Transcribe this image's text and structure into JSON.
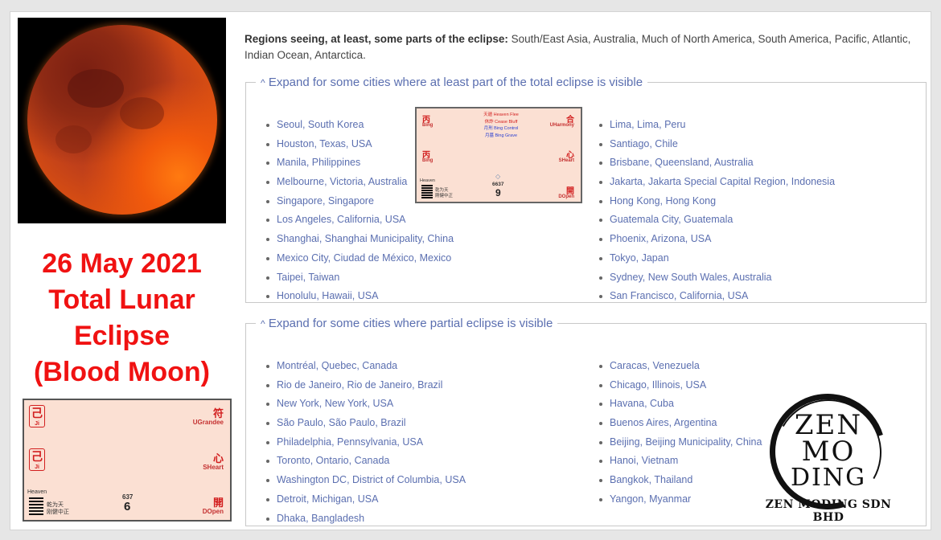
{
  "headline": {
    "line1": "26 May 2021",
    "line2": "Total Lunar",
    "line3": "Eclipse",
    "line4": "(Blood Moon)"
  },
  "regions": {
    "label": "Regions seeing, at least, some parts of the eclipse:",
    "text": " South/East Asia, Australia, Much of North America, South America, Pacific, Atlantic, Indian Ocean, Antarctica."
  },
  "total_section": {
    "legend": "Expand for some cities where at least part of the total eclipse is visible",
    "col1": [
      "Seoul, South Korea",
      "Houston, Texas, USA",
      "Manila, Philippines",
      "Melbourne, Victoria, Australia",
      "Singapore, Singapore",
      "Los Angeles, California, USA",
      "Shanghai, Shanghai Municipality, China",
      "Mexico City, Ciudad de México, Mexico",
      "Taipei, Taiwan",
      "Honolulu, Hawaii, USA"
    ],
    "col2": [
      "Lima, Lima, Peru",
      "Santiago, Chile",
      "Brisbane, Queensland, Australia",
      "Jakarta, Jakarta Special Capital Region, Indonesia",
      "Hong Kong, Hong Kong",
      "Guatemala City, Guatemala",
      "Phoenix, Arizona, USA",
      "Tokyo, Japan",
      "Sydney, New South Wales, Australia",
      "San Francisco, California, USA"
    ]
  },
  "partial_section": {
    "legend": "Expand for some cities where partial eclipse is visible",
    "col1": [
      "Montréal, Quebec, Canada",
      "Rio de Janeiro, Rio de Janeiro, Brazil",
      "New York, New York, USA",
      "São Paulo, São Paulo, Brazil",
      "Philadelphia, Pennsylvania, USA",
      "Toronto, Ontario, Canada",
      "Washington DC, District of Columbia, USA",
      "Detroit, Michigan, USA",
      "Dhaka, Bangladesh"
    ],
    "col2": [
      "Caracas, Venezuela",
      "Chicago, Illinois, USA",
      "Havana, Cuba",
      "Buenos Aires, Argentina",
      "Beijing, Beijing Municipality, China",
      "Hanoi, Vietnam",
      "Bangkok, Thailand",
      "Yangon, Myanmar"
    ]
  },
  "chart_small": {
    "tl_stem": "丙",
    "tl_sub": "Bing",
    "ml_stem": "丙",
    "ml_sub": "Bing",
    "tr_char": "合",
    "tr_sub": "UHarmony",
    "mr_char": "心",
    "mr_sub": "SHeart",
    "br_char": "開",
    "br_sub": "DOpen",
    "stars": [
      "天遁 Heaven Flee",
      "休詐 Cease Bluff",
      "月刑 Bing Control",
      "月墓 Bing Grave"
    ],
    "deity": "Heaven",
    "gua1": "乾为天",
    "gua2": "刚健中正",
    "code": "6637",
    "number": "9"
  },
  "chart_big": {
    "tl_stem": "己",
    "tl_sub": "Ji",
    "ml_stem": "己",
    "ml_sub": "Ji",
    "tr_char": "符",
    "tr_sub": "UGrandee",
    "mr_char": "心",
    "mr_sub": "SHeart",
    "br_char": "開",
    "br_sub": "DOpen",
    "deity": "Heaven",
    "gua1": "乾为天",
    "gua2": "刚健中正",
    "code": "637",
    "number": "6"
  },
  "logo": {
    "l1": "ZEN",
    "l2": "MO",
    "l3": "DING",
    "company": "ZEN MODING SDN BHD"
  }
}
